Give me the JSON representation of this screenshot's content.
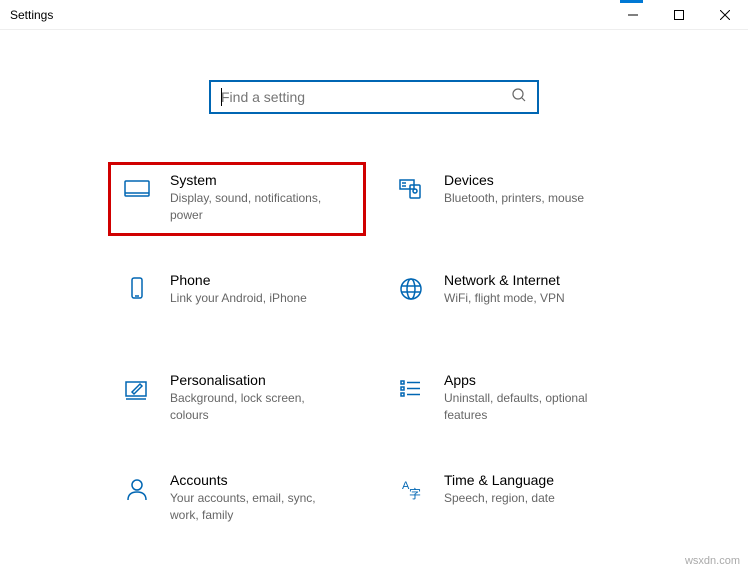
{
  "window": {
    "title": "Settings"
  },
  "search": {
    "placeholder": "Find a setting"
  },
  "tiles": {
    "system": {
      "title": "System",
      "desc": "Display, sound, notifications, power"
    },
    "devices": {
      "title": "Devices",
      "desc": "Bluetooth, printers, mouse"
    },
    "phone": {
      "title": "Phone",
      "desc": "Link your Android, iPhone"
    },
    "network": {
      "title": "Network & Internet",
      "desc": "WiFi, flight mode, VPN"
    },
    "personal": {
      "title": "Personalisation",
      "desc": "Background, lock screen, colours"
    },
    "apps": {
      "title": "Apps",
      "desc": "Uninstall, defaults, optional features"
    },
    "accounts": {
      "title": "Accounts",
      "desc": "Your accounts, email, sync, work, family"
    },
    "time": {
      "title": "Time & Language",
      "desc": "Speech, region, date"
    }
  },
  "watermark": "wsxdn.com"
}
